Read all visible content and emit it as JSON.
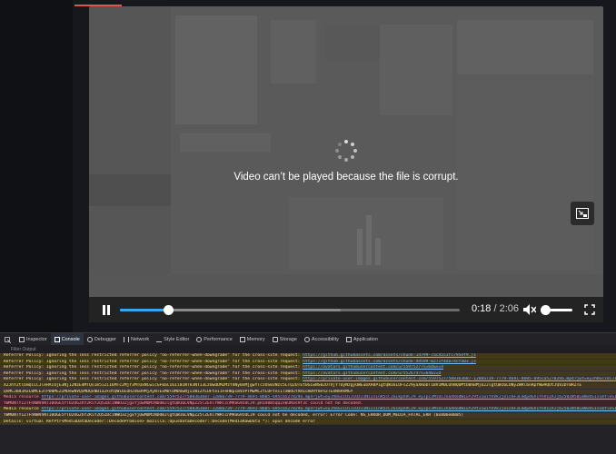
{
  "video": {
    "error_message": "Video can’t be played because the file is corrupt.",
    "current_time": "0:18",
    "separator": " / ",
    "duration": "2:06",
    "progress_fraction": 0.143,
    "volume_fraction": 1.0
  },
  "devtools": {
    "tabs": [
      {
        "label": "Inspector",
        "icon": "inspector-icon"
      },
      {
        "label": "Console",
        "icon": "console-icon"
      },
      {
        "label": "Debugger",
        "icon": "debugger-icon"
      },
      {
        "label": "Network",
        "icon": "network-icon"
      },
      {
        "label": "Style Editor",
        "icon": "style-editor-icon"
      },
      {
        "label": "Performance",
        "icon": "performance-icon"
      },
      {
        "label": "Memory",
        "icon": "memory-icon"
      },
      {
        "label": "Storage",
        "icon": "storage-icon"
      },
      {
        "label": "Accessibility",
        "icon": "accessibility-icon"
      },
      {
        "label": "Application",
        "icon": "application-icon"
      }
    ],
    "active_tab": "Console",
    "filter_placeholder": "Filter Output"
  },
  "console": {
    "messages": [
      {
        "level": "warn",
        "text": "Referrer Policy: Ignoring the less restricted referrer policy \"no-referrer-when-downgrade\" for the cross-site request: ",
        "url": "https://github.githubassets.com/assets/chunk-14799-7ac4551fc795ef9.js"
      },
      {
        "level": "warn",
        "text": "Referrer Policy: Ignoring the less restricted referrer policy \"no-referrer-when-downgrade\" for the cross-site request: ",
        "url": "https://github.githubassets.com/assets/chunk-49599-0271f4da74cfa03.js"
      },
      {
        "level": "warn",
        "text": "Referrer Policy: Ignoring the less restricted referrer policy \"no-referrer-when-downgrade\" for the cross-site request: ",
        "url": "https://avatars.githubusercontent.com/u/5597527?s=64&v=4"
      },
      {
        "level": "warn",
        "text": "Referrer Policy: Ignoring the less restricted referrer policy \"no-referrer-when-downgrade\" for the cross-site request: ",
        "url": "https://avatars.githubusercontent.com/u/552674?s=64&v=4"
      },
      {
        "level": "warn",
        "text": "Referrer Policy: Ignoring the less restricted referrer policy \"no-referrer-when-downgrade\" for the cross-site request: ",
        "url": "https://private-user-images.githubusercontent.com/5597527/508363687-1280a739-7779-4691-8b05-695ca527829a.mp4?jwt=eyJhbGciOiJIUzI1NiIsInR5cCI6IkpXVCJ9"
      },
      {
        "level": "warn",
        "text": "X2JhY2tlbmQiLCJleHAiOjE3NjI2NzE4MTQsIm5iZiI6MTc2MjY3MTUxNCwicGF0aCI6Ii81NTk3NTI3LzUwODM2MzY4Ny0xMjgwYTczOS03Nzc5LTQ2OTEtOGIwNS02OTVjYTUyNzgyOWEubXA0P1gtQW16LUFsZ29yaXRobT1BV1M0LUhNQUMtU0hBMjU2JlgtQW16LUNyZWRlbnRpYWw9QUtJQVZDT0RZTE",
        "url": ""
      },
      {
        "level": "warn",
        "text": "QnMCJBd3AxL0MCE3TPD0MEZIMDewNVQxMDQxNDIaJFdtQW16LUR2dGU9MjAyNTExMDlUMDUwNjI1WiZYLUFtei1FeHBpcmVzPTMwMCZYLUFtei1TaWduYXR1cmU9YmFhZTE4NmVkMGY",
        "url": ""
      },
      {
        "level": "err",
        "text": "Media resource ",
        "url": "https://private-user-images.githubusercontent.com/5597527/508363687-1280a739-7779-4691-8b05-695ca527829a.mp4?jwt=eyJhbGciOiJIUzI1NiIsInR5cCI6IkpXVCJ9.eyJpc3MiOiJnaXRodWIuY29tIiwiYXVkIjoicmF3LmdpdGh1YnVzZXJjb250ZW50LmNvbSIsImtleSI6ImtleTUi"
      },
      {
        "level": "err",
        "text": "YWM0NTY1ZTFhNWVhNTI0OGE5YTU2OGZhY2RiY2Q5ZDc1NWU3ZjgxYjUwMDMzNDdmJlgtQW16LVNpZ25lZEhlYWRlcnM9aG9zdCJ9.pR1V8m5qQ2xWJKUs9f3c could not be decoded.",
        "url": ""
      },
      {
        "level": "warn",
        "text": "Media resource ",
        "url": "https://private-user-images.githubusercontent.com/5597527/508363687-1280a739-7779-4691-8b05-695ca527829a.mp4?jwt=eyJhbGciOiJIUzI1NiIsInR5cCI6IkpXVCJ9.eyJpc3MiOiJnaXRodWIuY29tIiwiYXVkIjoicmF3LmdpdGh1YnVzZXJjb250ZW50LmNvbSIsImtleSI6ImtleTUi"
      },
      {
        "level": "warn",
        "text": "YWM0NTY1ZTFhNWVhNTI0OGE5YTU2OGZhY2RiY2Q5ZDc1NWU3ZjgxYjUwMDMzNDdmJlgtQW16LVNpZ25lZEhlYWRlcnM9aG9zdCJ9 could not be decoded, error: Error Code: NS_ERROR_DOM_MEDIA_FATAL_ERR (0x806e0005)",
        "url": ""
      },
      {
        "level": "warn",
        "text": "Details: virtual RefPtr<MediaDataDecoder::DecodePromise> mozilla::OpusDataDecoder::Decode(MediaRawData *): opus decode error",
        "url": ""
      }
    ]
  },
  "colors": {
    "accent": "#39a7f0",
    "warn_bg": "#42381c",
    "error_bg": "#3e2227",
    "tab_highlight": "#3b88d8"
  }
}
